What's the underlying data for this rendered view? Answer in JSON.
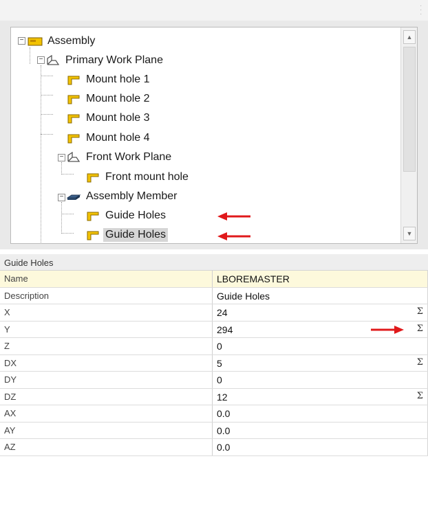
{
  "tree": {
    "nodes": [
      {
        "label": "Assembly"
      },
      {
        "label": "Primary Work Plane"
      },
      {
        "label": "Mount hole 1"
      },
      {
        "label": "Mount hole 2"
      },
      {
        "label": "Mount hole 3"
      },
      {
        "label": "Mount hole 4"
      },
      {
        "label": "Front Work Plane"
      },
      {
        "label": "Front mount hole"
      },
      {
        "label": "Assembly Member"
      },
      {
        "label": "Guide Holes"
      },
      {
        "label": "Guide Holes",
        "selected": true
      }
    ]
  },
  "properties": {
    "title": "Guide Holes",
    "rows": [
      {
        "name": "Name",
        "value": "LBOREMASTER"
      },
      {
        "name": "Description",
        "value": "Guide Holes"
      },
      {
        "name": "X",
        "value": "24",
        "sigma": "Σ"
      },
      {
        "name": "Y",
        "value": "294",
        "sigma": "Σ"
      },
      {
        "name": "Z",
        "value": "0"
      },
      {
        "name": "DX",
        "value": "5",
        "sigma": "Σ"
      },
      {
        "name": "DY",
        "value": "0"
      },
      {
        "name": "DZ",
        "value": "12",
        "sigma": "Σ"
      },
      {
        "name": "AX",
        "value": "0.0"
      },
      {
        "name": "AY",
        "value": "0.0"
      },
      {
        "name": "AZ",
        "value": "0.0"
      }
    ]
  },
  "colors": {
    "annotation_arrow": "#e0191b",
    "icon_yellow": "#f2c200"
  }
}
